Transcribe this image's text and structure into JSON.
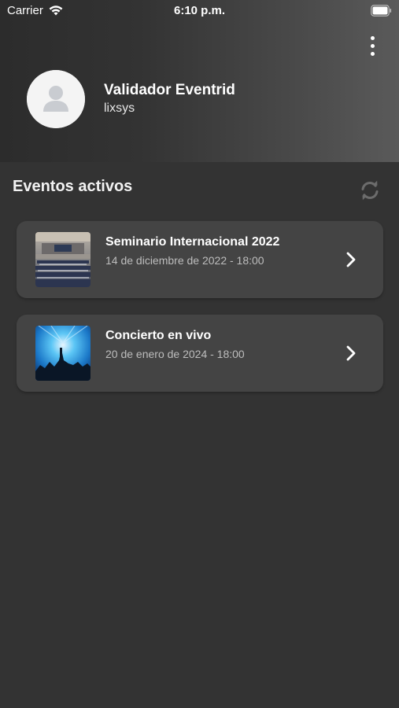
{
  "status_bar": {
    "carrier": "Carrier",
    "time": "6:10 p.m."
  },
  "header": {
    "menu_icon": "more-vertical-icon"
  },
  "profile": {
    "name": "Validador Eventrid",
    "username": "lixsys",
    "avatar_icon": "user-placeholder-icon"
  },
  "events_section": {
    "title": "Eventos activos",
    "refresh_icon": "refresh-icon",
    "events": [
      {
        "title": "Seminario Internacional 2022",
        "date": "14 de diciembre de 2022 - 18:00",
        "image": "conference-hall-image"
      },
      {
        "title": "Concierto en vivo",
        "date": "20 de enero de 2024 - 18:00",
        "image": "concert-crowd-image"
      }
    ]
  },
  "colors": {
    "background": "#333333",
    "card": "#444444",
    "text_primary": "#ffffff",
    "text_secondary": "#bdbdbd"
  }
}
